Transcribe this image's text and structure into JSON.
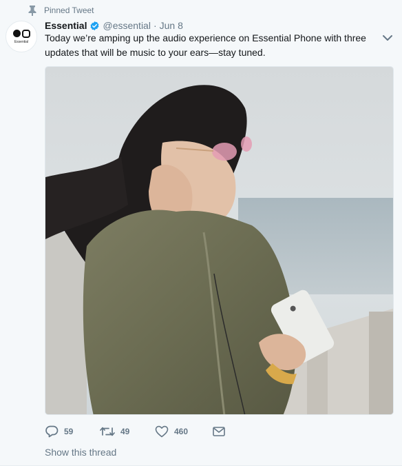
{
  "pinned": {
    "label": "Pinned Tweet",
    "icon": "pin-icon"
  },
  "author": {
    "avatar_text": "Essential",
    "name": "Essential",
    "verified_icon": "verified-badge-icon",
    "handle": "@essential",
    "separator": "·",
    "date": "Jun 8"
  },
  "tweet": {
    "text": "Today we’re amping up the audio experience on Essential Phone with three updates that will be music to your ears—stay tuned.",
    "media_alt": "photo"
  },
  "actions": {
    "reply": {
      "icon": "reply-icon",
      "count": "59"
    },
    "retweet": {
      "icon": "retweet-icon",
      "count": "49"
    },
    "like": {
      "icon": "heart-icon",
      "count": "460"
    },
    "message": {
      "icon": "envelope-icon"
    }
  },
  "thread_link": "Show this thread",
  "colors": {
    "text": "#14171a",
    "muted": "#657786",
    "background": "#f5f8fa",
    "verified": "#1da1f2"
  }
}
